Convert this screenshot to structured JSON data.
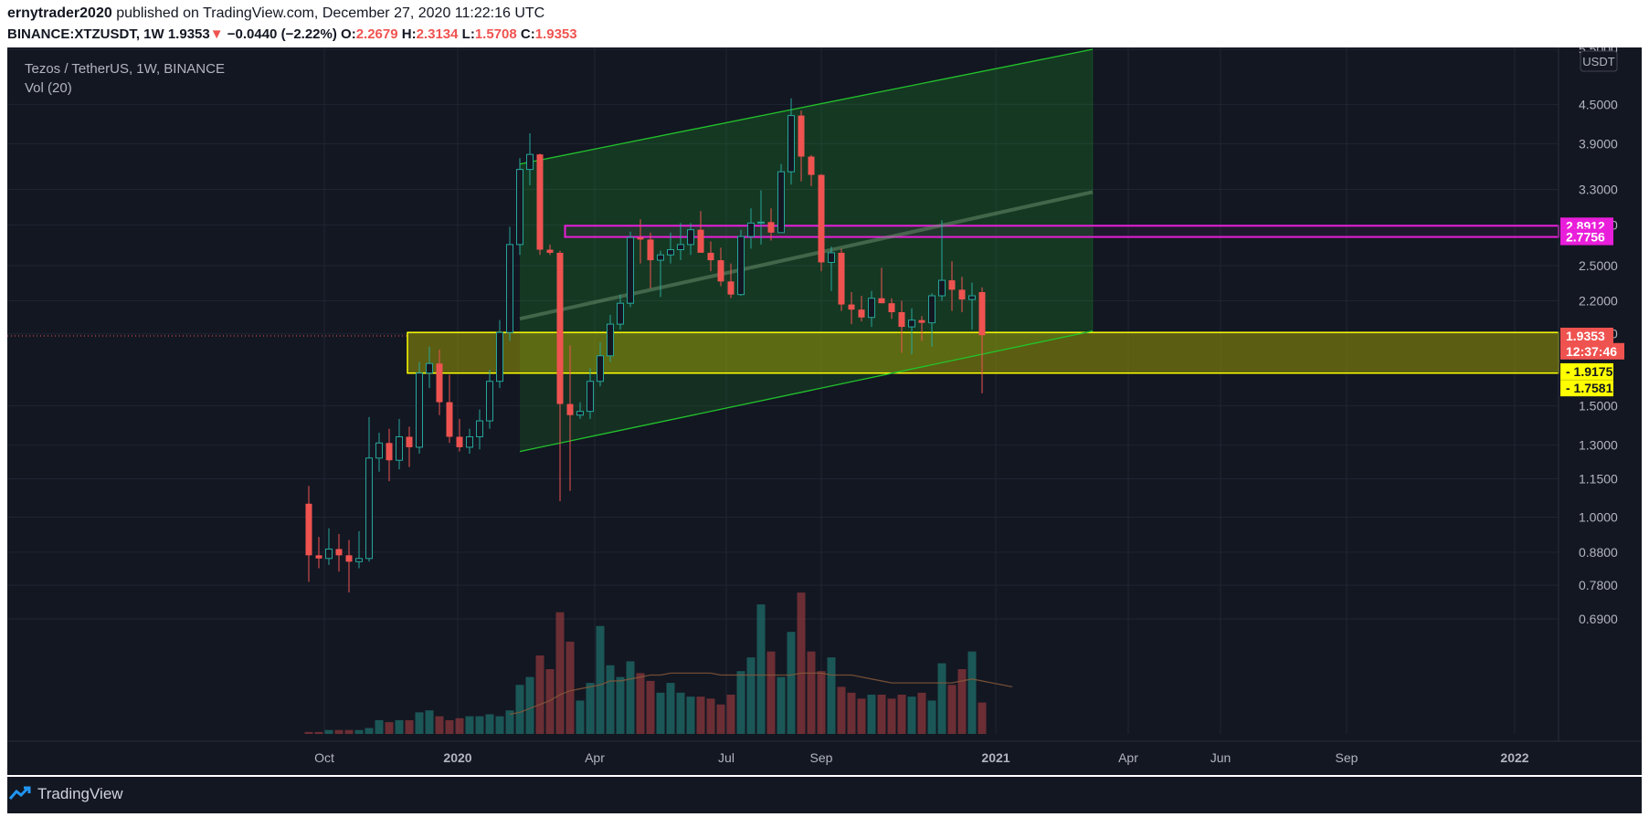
{
  "header": {
    "publisher": "ernytrader2020",
    "published_text": " published on TradingView.com, December 27, 2020 11:22:16 UTC",
    "symbol": "BINANCE:XTZUSDT, 1W",
    "last": "1.9353",
    "arrow": "▼",
    "change": "−0.0440 (−2.22%)",
    "o_label": "O:",
    "o": "2.2679",
    "h_label": "H:",
    "h": "2.3134",
    "l_label": "L:",
    "l": "1.5708",
    "c_label": "C:",
    "c": "1.9353"
  },
  "legend": {
    "title": "Tezos / TetherUS, 1W, BINANCE",
    "vol": "Vol (20)"
  },
  "footer": {
    "brand": "TradingView"
  },
  "colors": {
    "bg": "#131722",
    "up": "#26a69a",
    "down": "#ef5350",
    "channel": "#22c52b",
    "zone_yellow": "#ffff00",
    "zone_magenta": "#e91eda"
  },
  "chart_data": {
    "type": "candlestick",
    "title": "Tezos / TetherUS, 1W, BINANCE",
    "y_scale": "log",
    "currency": "USDT",
    "y_ticks": [
      5.5,
      4.5,
      3.9,
      3.3,
      2.9,
      2.5,
      2.2,
      1.95,
      1.5,
      1.3,
      1.15,
      1.0,
      0.88,
      0.78,
      0.69
    ],
    "x_labels": [
      "Oct",
      "2020",
      "Apr",
      "Jul",
      "Sep",
      "2021",
      "Apr",
      "Jun",
      "Sep",
      "2022"
    ],
    "price_labels": [
      {
        "text": "2.8912",
        "value": 2.8912,
        "color": "#e91eda",
        "text_color": "#ffffff"
      },
      {
        "text": "2.7756",
        "value": 2.7756,
        "color": "#e91eda",
        "text_color": "#ffffff"
      },
      {
        "text": "1.9353",
        "value": 1.9353,
        "color": "#ef5350",
        "text_color": "#ffffff"
      },
      {
        "text": "12:37:46",
        "value": 1.83,
        "color": "#ef5350",
        "text_color": "#ffffff"
      },
      {
        "text": "1.9175",
        "value": 1.7,
        "color": "#ffff00",
        "text_color": "#131722"
      },
      {
        "text": "1.7581",
        "value": 1.6,
        "color": "#ffff00",
        "text_color": "#131722"
      }
    ],
    "candles": [
      {
        "o": 1.05,
        "h": 1.12,
        "l": 0.79,
        "c": 0.87
      },
      {
        "o": 0.87,
        "h": 0.93,
        "l": 0.83,
        "c": 0.86
      },
      {
        "o": 0.86,
        "h": 0.96,
        "l": 0.84,
        "c": 0.89
      },
      {
        "o": 0.89,
        "h": 0.94,
        "l": 0.82,
        "c": 0.87
      },
      {
        "o": 0.87,
        "h": 0.92,
        "l": 0.76,
        "c": 0.85
      },
      {
        "o": 0.85,
        "h": 0.95,
        "l": 0.83,
        "c": 0.86
      },
      {
        "o": 0.86,
        "h": 1.44,
        "l": 0.85,
        "c": 1.24
      },
      {
        "o": 1.24,
        "h": 1.36,
        "l": 1.18,
        "c": 1.31
      },
      {
        "o": 1.31,
        "h": 1.38,
        "l": 1.14,
        "c": 1.23
      },
      {
        "o": 1.23,
        "h": 1.43,
        "l": 1.19,
        "c": 1.34
      },
      {
        "o": 1.34,
        "h": 1.39,
        "l": 1.2,
        "c": 1.29
      },
      {
        "o": 1.29,
        "h": 1.76,
        "l": 1.26,
        "c": 1.69
      },
      {
        "o": 1.69,
        "h": 1.86,
        "l": 1.6,
        "c": 1.75
      },
      {
        "o": 1.75,
        "h": 1.84,
        "l": 1.45,
        "c": 1.52
      },
      {
        "o": 1.52,
        "h": 1.68,
        "l": 1.31,
        "c": 1.34
      },
      {
        "o": 1.34,
        "h": 1.43,
        "l": 1.27,
        "c": 1.29
      },
      {
        "o": 1.29,
        "h": 1.38,
        "l": 1.26,
        "c": 1.34
      },
      {
        "o": 1.34,
        "h": 1.48,
        "l": 1.28,
        "c": 1.42
      },
      {
        "o": 1.42,
        "h": 1.71,
        "l": 1.38,
        "c": 1.64
      },
      {
        "o": 1.64,
        "h": 2.05,
        "l": 1.6,
        "c": 1.96
      },
      {
        "o": 1.96,
        "h": 2.88,
        "l": 1.9,
        "c": 2.7
      },
      {
        "o": 2.7,
        "h": 3.7,
        "l": 2.6,
        "c": 3.55
      },
      {
        "o": 3.55,
        "h": 4.05,
        "l": 3.35,
        "c": 3.75
      },
      {
        "o": 3.75,
        "h": 3.76,
        "l": 2.6,
        "c": 2.65
      },
      {
        "o": 2.65,
        "h": 2.7,
        "l": 2.6,
        "c": 2.62
      },
      {
        "o": 2.62,
        "h": 2.64,
        "l": 1.06,
        "c": 1.51
      },
      {
        "o": 1.51,
        "h": 1.87,
        "l": 1.1,
        "c": 1.45
      },
      {
        "o": 1.45,
        "h": 1.52,
        "l": 1.43,
        "c": 1.47
      },
      {
        "o": 1.47,
        "h": 1.72,
        "l": 1.43,
        "c": 1.64
      },
      {
        "o": 1.64,
        "h": 1.89,
        "l": 1.61,
        "c": 1.8
      },
      {
        "o": 1.8,
        "h": 2.09,
        "l": 1.76,
        "c": 2.02
      },
      {
        "o": 2.02,
        "h": 2.25,
        "l": 1.98,
        "c": 2.18
      },
      {
        "o": 2.18,
        "h": 2.83,
        "l": 2.15,
        "c": 2.77
      },
      {
        "o": 2.77,
        "h": 2.96,
        "l": 2.52,
        "c": 2.75
      },
      {
        "o": 2.75,
        "h": 2.82,
        "l": 2.3,
        "c": 2.55
      },
      {
        "o": 2.55,
        "h": 2.64,
        "l": 2.23,
        "c": 2.6
      },
      {
        "o": 2.6,
        "h": 2.82,
        "l": 2.52,
        "c": 2.65
      },
      {
        "o": 2.65,
        "h": 2.92,
        "l": 2.55,
        "c": 2.7
      },
      {
        "o": 2.7,
        "h": 2.92,
        "l": 2.6,
        "c": 2.85
      },
      {
        "o": 2.85,
        "h": 3.05,
        "l": 2.65,
        "c": 2.62
      },
      {
        "o": 2.62,
        "h": 2.73,
        "l": 2.45,
        "c": 2.55
      },
      {
        "o": 2.55,
        "h": 2.67,
        "l": 2.32,
        "c": 2.36
      },
      {
        "o": 2.36,
        "h": 2.52,
        "l": 2.22,
        "c": 2.25
      },
      {
        "o": 2.25,
        "h": 2.85,
        "l": 2.24,
        "c": 2.78
      },
      {
        "o": 2.78,
        "h": 3.08,
        "l": 2.66,
        "c": 2.92
      },
      {
        "o": 2.92,
        "h": 3.29,
        "l": 2.7,
        "c": 2.93
      },
      {
        "o": 2.93,
        "h": 3.08,
        "l": 2.74,
        "c": 2.82
      },
      {
        "o": 2.82,
        "h": 3.62,
        "l": 2.86,
        "c": 3.52
      },
      {
        "o": 3.52,
        "h": 4.6,
        "l": 3.36,
        "c": 4.32
      },
      {
        "o": 4.32,
        "h": 4.4,
        "l": 3.4,
        "c": 3.72
      },
      {
        "o": 3.72,
        "h": 3.74,
        "l": 3.34,
        "c": 3.48
      },
      {
        "o": 3.48,
        "h": 3.49,
        "l": 2.45,
        "c": 2.53
      },
      {
        "o": 2.53,
        "h": 2.68,
        "l": 2.28,
        "c": 2.62
      },
      {
        "o": 2.62,
        "h": 2.66,
        "l": 2.12,
        "c": 2.17
      },
      {
        "o": 2.17,
        "h": 2.27,
        "l": 2.02,
        "c": 2.13
      },
      {
        "o": 2.13,
        "h": 2.24,
        "l": 2.04,
        "c": 2.07
      },
      {
        "o": 2.07,
        "h": 2.28,
        "l": 2.0,
        "c": 2.22
      },
      {
        "o": 2.22,
        "h": 2.48,
        "l": 2.18,
        "c": 2.18
      },
      {
        "o": 2.18,
        "h": 2.22,
        "l": 2.06,
        "c": 2.11
      },
      {
        "o": 2.11,
        "h": 2.2,
        "l": 1.82,
        "c": 2.0
      },
      {
        "o": 2.0,
        "h": 2.14,
        "l": 1.81,
        "c": 2.05
      },
      {
        "o": 2.05,
        "h": 2.08,
        "l": 1.9,
        "c": 2.03
      },
      {
        "o": 2.03,
        "h": 2.26,
        "l": 1.86,
        "c": 2.24
      },
      {
        "o": 2.24,
        "h": 2.95,
        "l": 2.2,
        "c": 2.37
      },
      {
        "o": 2.37,
        "h": 2.54,
        "l": 2.12,
        "c": 2.29
      },
      {
        "o": 2.29,
        "h": 2.4,
        "l": 2.11,
        "c": 2.21
      },
      {
        "o": 2.21,
        "h": 2.35,
        "l": 1.98,
        "c": 2.24
      },
      {
        "o": 2.27,
        "h": 2.31,
        "l": 1.57,
        "c": 1.94
      }
    ],
    "volume_relative": [
      0.01,
      0.01,
      0.02,
      0.02,
      0.02,
      0.02,
      0.03,
      0.07,
      0.06,
      0.07,
      0.07,
      0.11,
      0.12,
      0.09,
      0.07,
      0.08,
      0.09,
      0.09,
      0.1,
      0.09,
      0.12,
      0.25,
      0.29,
      0.4,
      0.33,
      0.62,
      0.47,
      0.17,
      0.26,
      0.55,
      0.35,
      0.29,
      0.37,
      0.31,
      0.27,
      0.21,
      0.26,
      0.21,
      0.19,
      0.19,
      0.18,
      0.15,
      0.2,
      0.32,
      0.39,
      0.66,
      0.42,
      0.29,
      0.52,
      0.72,
      0.42,
      0.32,
      0.39,
      0.24,
      0.21,
      0.18,
      0.2,
      0.2,
      0.18,
      0.2,
      0.19,
      0.21,
      0.17,
      0.36,
      0.25,
      0.33,
      0.42,
      0.16,
      0.24,
      0.2,
      0.24
    ],
    "volume_ma_relative": [
      null,
      null,
      null,
      null,
      null,
      null,
      null,
      null,
      null,
      null,
      null,
      null,
      null,
      null,
      null,
      null,
      null,
      null,
      null,
      null,
      0.1,
      0.11,
      0.13,
      0.15,
      0.17,
      0.2,
      0.22,
      0.23,
      0.24,
      0.25,
      0.27,
      0.27,
      0.28,
      0.29,
      0.3,
      0.3,
      0.31,
      0.31,
      0.31,
      0.31,
      0.31,
      0.3,
      0.3,
      0.3,
      0.3,
      0.3,
      0.3,
      0.3,
      0.3,
      0.31,
      0.31,
      0.31,
      0.3,
      0.3,
      0.3,
      0.29,
      0.28,
      0.27,
      0.26,
      0.26,
      0.26,
      0.26,
      0.26,
      0.26,
      0.26,
      0.27,
      0.28,
      0.27,
      0.26,
      0.25,
      0.24
    ],
    "annotations": {
      "channel_upper": [
        {
          "i": 21,
          "v": 3.62
        },
        {
          "i": 78,
          "v": 5.5
        }
      ],
      "channel_mid": [
        {
          "i": 21,
          "v": 2.06
        },
        {
          "i": 78,
          "v": 3.27
        }
      ],
      "channel_lower": [
        {
          "i": 21,
          "v": 1.27
        },
        {
          "i": 78,
          "v": 1.97
        }
      ],
      "yellow_zone": [
        1.69,
        1.96
      ],
      "magenta_zone": [
        2.7756,
        2.8912
      ],
      "dotted_price": 1.9353
    }
  }
}
